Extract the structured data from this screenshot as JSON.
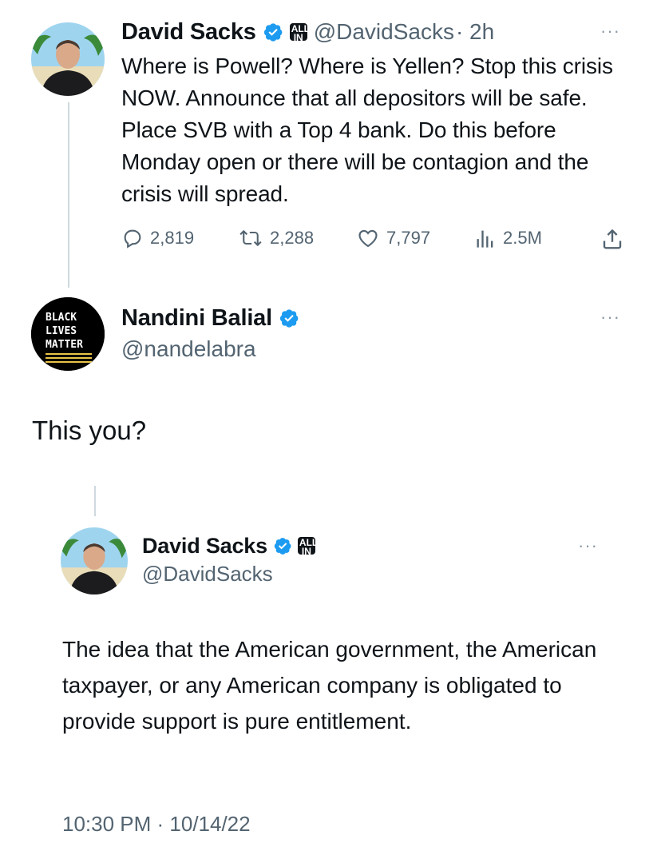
{
  "tweet1": {
    "name": "David Sacks",
    "badge_text": "ALL IN",
    "handle": "@DavidSacks",
    "time": "· 2h",
    "more": "···",
    "text": "Where is Powell? Where is Yellen? Stop this crisis NOW. Announce that all depositors will be safe. Place SVB with a Top 4 bank. Do this before Monday open or there will be contagion and the crisis will spread.",
    "replies": "2,819",
    "retweets": "2,288",
    "likes": "7,797",
    "views": "2.5M"
  },
  "tweet2": {
    "name": "Nandini Balial",
    "handle": "@nandelabra",
    "more": "···",
    "avatar_text": [
      "BLACK",
      "LIVES",
      "MATTER"
    ],
    "text": "This you?"
  },
  "quoted": {
    "name": "David Sacks",
    "badge_text": "ALL IN",
    "handle": "@DavidSacks",
    "more": "···",
    "text": "The idea that the American government, the American taxpayer, or any American company is obligated to provide support is pure entitlement.",
    "timestamp": "10:30 PM · 10/14/22"
  },
  "colors": {
    "verified": "#1d9bf0",
    "muted": "#536471",
    "text": "#0f1419"
  },
  "icons": [
    "verified-icon",
    "allin-badge-icon",
    "reply-icon",
    "retweet-icon",
    "like-icon",
    "views-icon",
    "share-icon",
    "more-icon"
  ]
}
